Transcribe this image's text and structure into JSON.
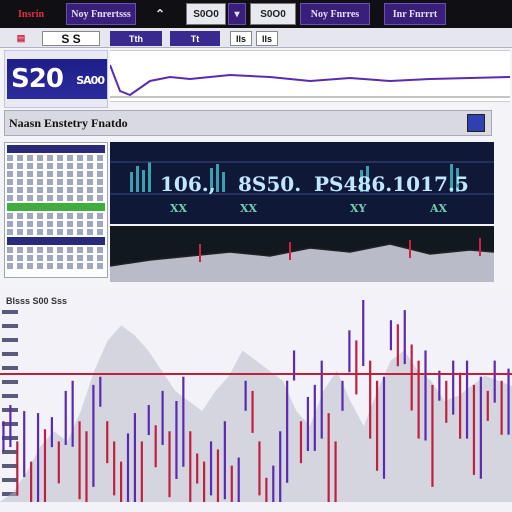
{
  "topbar": {
    "brand": "Insrin",
    "btn1": "Noy Fnrertsss",
    "btn2": "S0O0",
    "btn3": "S0O0",
    "btn4": "Noy Fnrres",
    "btn5": "Inr Fnrrrt"
  },
  "row2": {
    "symbol": "S S",
    "items": [
      "Tth",
      "Tt",
      "lls",
      "lls"
    ]
  },
  "ticker": {
    "big": "S20",
    "small": "SA00"
  },
  "title": "Naasn Enstetry Fnatdo",
  "dashboard": {
    "value1": "106.,",
    "value2": "8S50.",
    "value3": "PS486.1017.5",
    "marks": [
      "XX",
      "XX",
      "XY",
      "AX"
    ]
  },
  "main": {
    "header": "Blsss S00 Sss"
  },
  "colors": {
    "red": "#d02040",
    "purple": "#5a2ab0",
    "navy": "#1e1e8a"
  },
  "chart_data": {
    "type": "line",
    "series": [
      {
        "values": [
          40,
          48,
          30,
          45,
          20,
          44,
          36,
          42,
          30,
          55,
          60,
          40,
          35,
          58,
          62,
          40,
          30,
          20,
          34,
          44,
          30,
          48,
          38,
          55,
          35,
          50,
          62,
          35,
          24,
          20,
          30,
          26,
          40,
          18,
          22,
          60,
          55,
          30,
          12,
          18,
          35,
          60,
          75,
          40,
          52,
          58,
          70,
          44,
          30,
          60,
          85,
          80,
          100,
          70,
          60,
          62,
          90,
          88,
          95,
          78,
          70,
          75,
          58,
          65,
          60,
          70,
          64,
          70,
          58,
          62,
          55,
          70,
          60,
          66
        ]
      },
      {
        "values": [
          0,
          20,
          60,
          110,
          140,
          120,
          180,
          260,
          320,
          350,
          330,
          300,
          260,
          220,
          200,
          180,
          220,
          250,
          300,
          280,
          260,
          240,
          180,
          150,
          220,
          260,
          200,
          150,
          220,
          280,
          300,
          260,
          240,
          200,
          210,
          230,
          250,
          240,
          230
        ]
      }
    ]
  }
}
